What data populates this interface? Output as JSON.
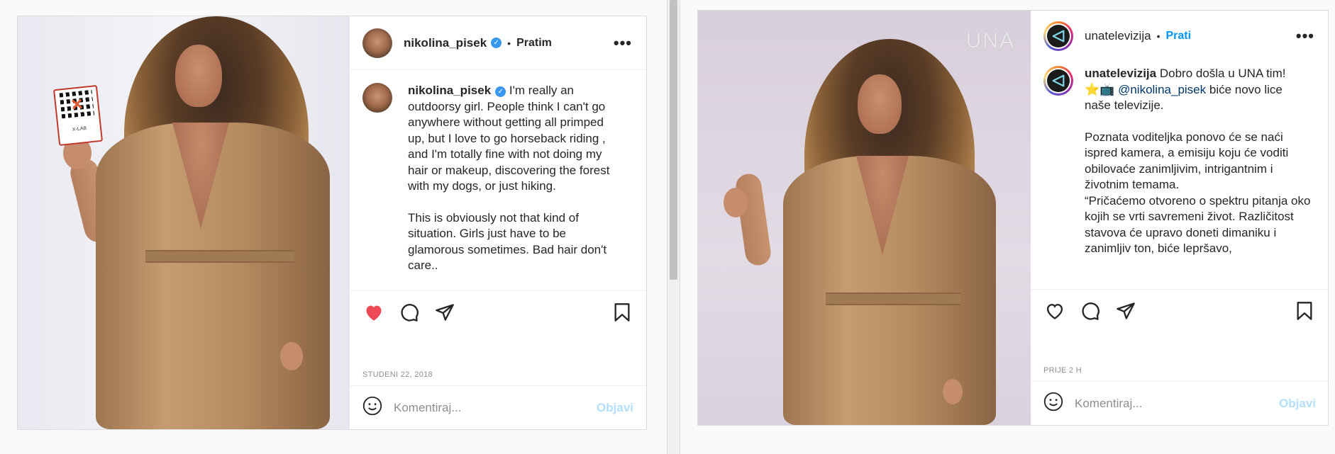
{
  "colors": {
    "accent": "#0095f6",
    "like_red": "#ed4956",
    "post_disabled": "#b2dffc",
    "muted": "#8e8e8e"
  },
  "left_post": {
    "header": {
      "username": "nikolina_pisek",
      "separator": "•",
      "follow_state": "Pratim",
      "more_icon": "more-horizontal-icon"
    },
    "product_label": "X-LAB",
    "caption": {
      "username": "nikolina_pisek",
      "paragraph_1": "I'm really an outdoorsy girl. People think I can't go anywhere without getting all primped up, but I love to go horseback riding , and I'm totally fine with not doing my hair or makeup, discovering the forest with my dogs, or just hiking.",
      "paragraph_2": "This is obviously not that kind of situation. Girls just have to be glamorous sometimes. Bad hair don't care.."
    },
    "actions": {
      "liked": true,
      "icons": [
        "heart-filled-icon",
        "comment-icon",
        "share-icon",
        "bookmark-icon"
      ]
    },
    "date": "STUDENI 22, 2018",
    "comment": {
      "placeholder": "Komentiraj...",
      "post_label": "Objavi"
    }
  },
  "right_post": {
    "watermark": "UNA",
    "header": {
      "username": "unatelevizija",
      "separator": "•",
      "follow_state": "Prati",
      "more_icon": "more-horizontal-icon"
    },
    "caption": {
      "username": "unatelevizija",
      "line_1": "Dobro došla u UNA tim!",
      "emoji": "⭐📺",
      "mention": "@nikolina_pisek",
      "line_2": "biće novo lice naše televizije.",
      "paragraph_2": "Poznata voditeljka ponovo će se naći ispred kamera, a emisiju koju će voditi obilovaće zanimljivim, intrigantnim i životnim temama.",
      "paragraph_3": "“Pričaćemo otvoreno o spektru pitanja oko kojih se vrti savremeni život. Različitost stavova će upravo doneti dimaniku i zanimljiv ton, biće lepršavo,"
    },
    "actions": {
      "liked": false,
      "icons": [
        "heart-icon",
        "comment-icon",
        "share-icon",
        "bookmark-icon"
      ]
    },
    "date": "PRIJE 2 H",
    "comment": {
      "placeholder": "Komentiraj...",
      "post_label": "Objavi"
    }
  }
}
